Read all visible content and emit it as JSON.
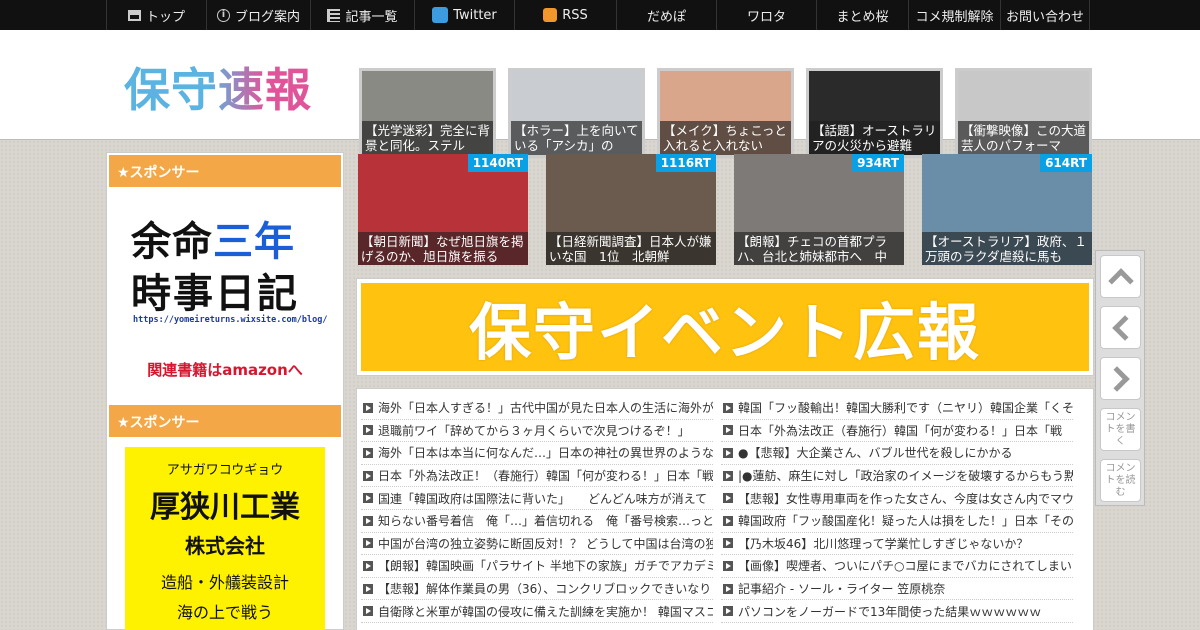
{
  "nav": [
    {
      "label": "トップ",
      "icon": "home-icon"
    },
    {
      "label": "ブログ案内",
      "icon": "info-icon"
    },
    {
      "label": "記事一覧",
      "icon": "list-icon"
    },
    {
      "label": "Twitter",
      "icon": "twitter-icon"
    },
    {
      "label": "RSS",
      "icon": "rss-icon"
    },
    {
      "label": "だめぽ",
      "icon": ""
    },
    {
      "label": "ワロタ",
      "icon": ""
    },
    {
      "label": "まとめ桜",
      "icon": ""
    },
    {
      "label": "コメ規制解除",
      "icon": ""
    },
    {
      "label": "お問い合わせ",
      "icon": ""
    }
  ],
  "logo": "保守速報",
  "top_thumbs": [
    {
      "caption": "【光学迷彩】完全に背景と同化。ステル",
      "color": "#8a8a85"
    },
    {
      "caption": "【ホラー】上を向いている「アシカ」の",
      "color": "#c9ccd0"
    },
    {
      "caption": "【メイク】ちょこっと入れると入れない",
      "color": "#d9a58b"
    },
    {
      "caption": "【話題】オーストラリアの火災から避難",
      "color": "#2a2a2a"
    },
    {
      "caption": "【衝撃映像】この大道芸人のパフォーマ",
      "color": "#c8c8c8"
    }
  ],
  "sponsor_label": "★スポンサー",
  "ad1": {
    "line1_black": "余命",
    "line1_blue": "三年",
    "line2": "時事日記",
    "url": "https://yomeireturns.wixsite.com/blog/",
    "amazon": "関連書籍はamazonへ"
  },
  "ad2": {
    "kana": "アサガワコウギョウ",
    "name": "厚狭川工業",
    "company": "株式会社",
    "business": "造船・外艤装設計",
    "more": "海の上で戦う"
  },
  "rt_cards": [
    {
      "rt": "1140RT",
      "caption": "【朝日新聞】なぜ旭日旗を掲げるのか、旭日旗を振る",
      "color": "#b8323a"
    },
    {
      "rt": "1116RT",
      "caption": "【日経新聞調査】日本人が嫌いな国　1位　北朝鮮",
      "color": "#6b5a4e"
    },
    {
      "rt": "934RT",
      "caption": "【朗報】チェコの首都プラハ、台北と姉妹都市へ　中",
      "color": "#7d7a78"
    },
    {
      "rt": "614RT",
      "caption": "【オーストラリア】政府、１万頭のラクダ虐殺に馬も",
      "color": "#6a8ea8"
    }
  ],
  "banner": "保守イベント広報",
  "links_left": [
    "海外「日本人すぎる！」古代中国が見た日本人の生活に海外が",
    "退職前ワイ「辞めてから３ヶ月くらいで次見つけるぞ！」",
    "海外「日本は本当に何なんだ…」日本の神社の異世界のような",
    "日本「外為法改正！（春施行）韓国「何が変わる！」日本「戦",
    "国連「韓国政府は国際法に背いた」　　どんどん味方が消えて",
    "知らない番号着信　俺「…」着信切れる　俺「番号検索…っと",
    "中国が台湾の独立姿勢に断固反対！？ どうして中国は台湾の独",
    "【朗報】韓国映画「パラサイト 半地下の家族」ガチでアカデミ",
    "【悲報】解体作業員の男（36）、コンクリブロックできいなり",
    "自衛隊と米軍が韓国の侵攻に備えた訓練を実施か！ 韓国マスコ"
  ],
  "links_right": [
    "韓国「フッ酸輸出！韓国大勝利です（ニヤリ）韓国企業「くそ",
    "日本「外為法改正（春施行）韓国「何が変わる！」日本「戦",
    "●【悲報】大企業さん、バブル世代を殺しにかかる",
    "|●蓮舫、麻生に対し「政治家のイメージを破壊するからもう黙",
    "【悲報】女性専用車両を作った女さん、今度は女さん内でマウ",
    "韓国政府「フッ酸国産化！疑った人は損をした！」日本「その",
    "【乃木坂46】北川悠理って学業忙しすぎじゃないか？",
    "【画像】喫煙者、ついにパチ○コ屋にまでバカにされてしまい",
    "記事紹介 - ソール・ライター 笠原桃奈",
    "パソコンをノーガードで13年間使った結果ｗｗｗｗｗｗ"
  ],
  "side_buttons": {
    "comment_write": "コメントを書く",
    "comment_read": "コメントを読む"
  }
}
